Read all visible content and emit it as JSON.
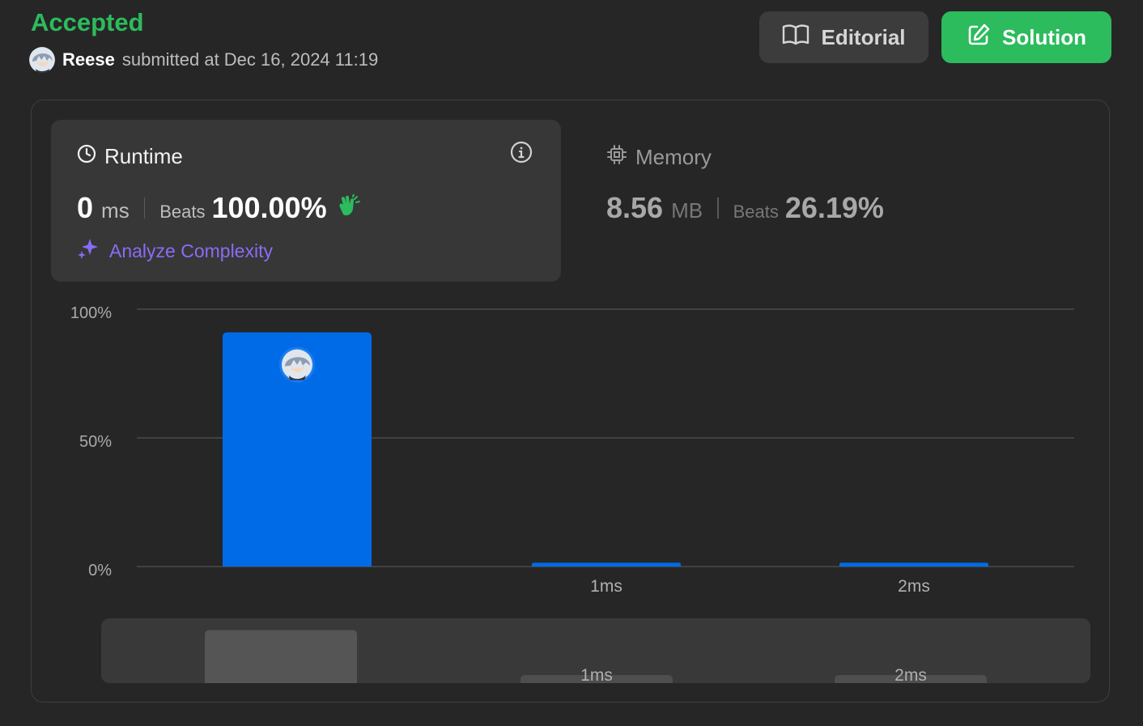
{
  "header": {
    "status": "Accepted",
    "user_name": "Reese",
    "submitted_text": "submitted at Dec 16, 2024 11:19",
    "editorial_label": "Editorial",
    "solution_label": "Solution"
  },
  "runtime": {
    "title": "Runtime",
    "value": "0",
    "unit": "ms",
    "beats_label": "Beats",
    "beats_value": "100.00%",
    "analyze_label": "Analyze Complexity"
  },
  "memory": {
    "title": "Memory",
    "value": "8.56",
    "unit": "MB",
    "beats_label": "Beats",
    "beats_value": "26.19%"
  },
  "colors": {
    "accepted": "#2cbb5d",
    "bar": "#006be6",
    "analyze": "#8a6cf5"
  },
  "chart_data": {
    "type": "bar",
    "categories": [
      "",
      "1ms",
      "2ms"
    ],
    "values": [
      91,
      1.5,
      1.5
    ],
    "ylim": [
      0,
      100
    ],
    "ytick_labels": [
      "100%",
      "50%",
      "0%"
    ],
    "yticks": [
      100,
      50,
      0
    ],
    "grid": true,
    "highlighted_index": 0
  },
  "overview": {
    "categories": [
      "",
      "1ms",
      "2ms"
    ],
    "values": [
      91,
      1.5,
      1.5
    ]
  }
}
